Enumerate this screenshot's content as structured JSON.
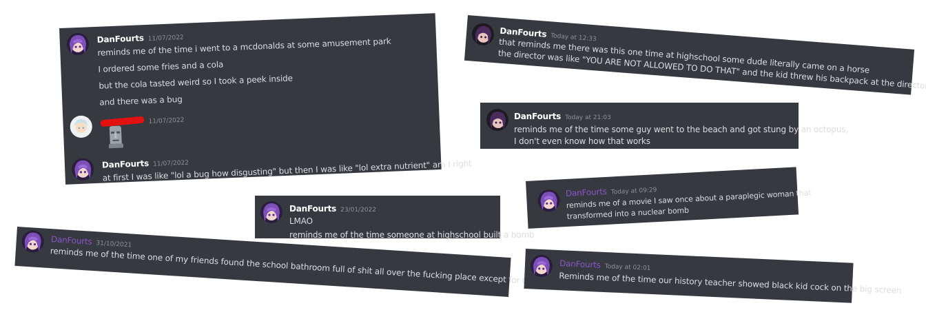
{
  "cards": [
    {
      "messages": [
        {
          "author": "DanFourts",
          "time": "11/07/2022",
          "lines": [
            "reminds me of the time i went to a mcdonalds at some amusement park",
            "I ordered some fries and a cola",
            "but the cola tasted weird so I took a peek inside",
            "and there was a bug"
          ]
        },
        {
          "author": "",
          "time": "11/07/2022",
          "emoji": "moai-emoji"
        },
        {
          "author": "DanFourts",
          "time": "11/07/2022",
          "lines": [
            "at first I was like \"lol a bug how disgusting\" but then I was like \"lol extra nutrient\" am I right"
          ]
        }
      ]
    },
    {
      "messages": [
        {
          "author": "DanFourts",
          "time": "Today at 12:33",
          "lines": [
            "that reminds me there was this one time at highschool some dude literally came on a horse",
            "the director was like \"YOU ARE NOT ALLOWED TO DO THAT\" and the kid threw his backpack at the director's face"
          ]
        }
      ]
    },
    {
      "messages": [
        {
          "author": "DanFourts",
          "time": "Today at 21:03",
          "lines": [
            "reminds me of the time some guy went to the beach and got stung by an octopus,",
            "I don't even know how that works"
          ]
        }
      ]
    },
    {
      "messages": [
        {
          "author": "DanFourts",
          "time": "Today at 09:29",
          "lines": [
            "reminds me of a movie I saw once about a paraplegic woman that",
            "transformed into a nuclear bomb"
          ]
        }
      ]
    },
    {
      "messages": [
        {
          "author": "DanFourts",
          "time": "23/01/2022",
          "lines": [
            "LMAO",
            "reminds me of the time someone at highschool built a bomb"
          ]
        }
      ]
    },
    {
      "messages": [
        {
          "author": "DanFourts",
          "time": "31/10/2021",
          "lines": [
            "reminds me of the time one of my friends found the school bathroom full of shit all over the fucking place except for the fucking toilets"
          ]
        }
      ]
    },
    {
      "messages": [
        {
          "author": "DanFourts",
          "time": "Today at 02:01",
          "lines": [
            "Reminds me of the time our history teacher showed black kid cock on the big screen"
          ]
        }
      ]
    }
  ],
  "colors": {
    "card_bg": "#36393f",
    "text": "#dcddde",
    "timestamp": "#8e9297",
    "purple_name": "#8a56c9",
    "redaction": "#e31010"
  },
  "icons": [
    "avatar-anime-girl",
    "avatar-light",
    "moai-emoji",
    "skull-emoji"
  ]
}
